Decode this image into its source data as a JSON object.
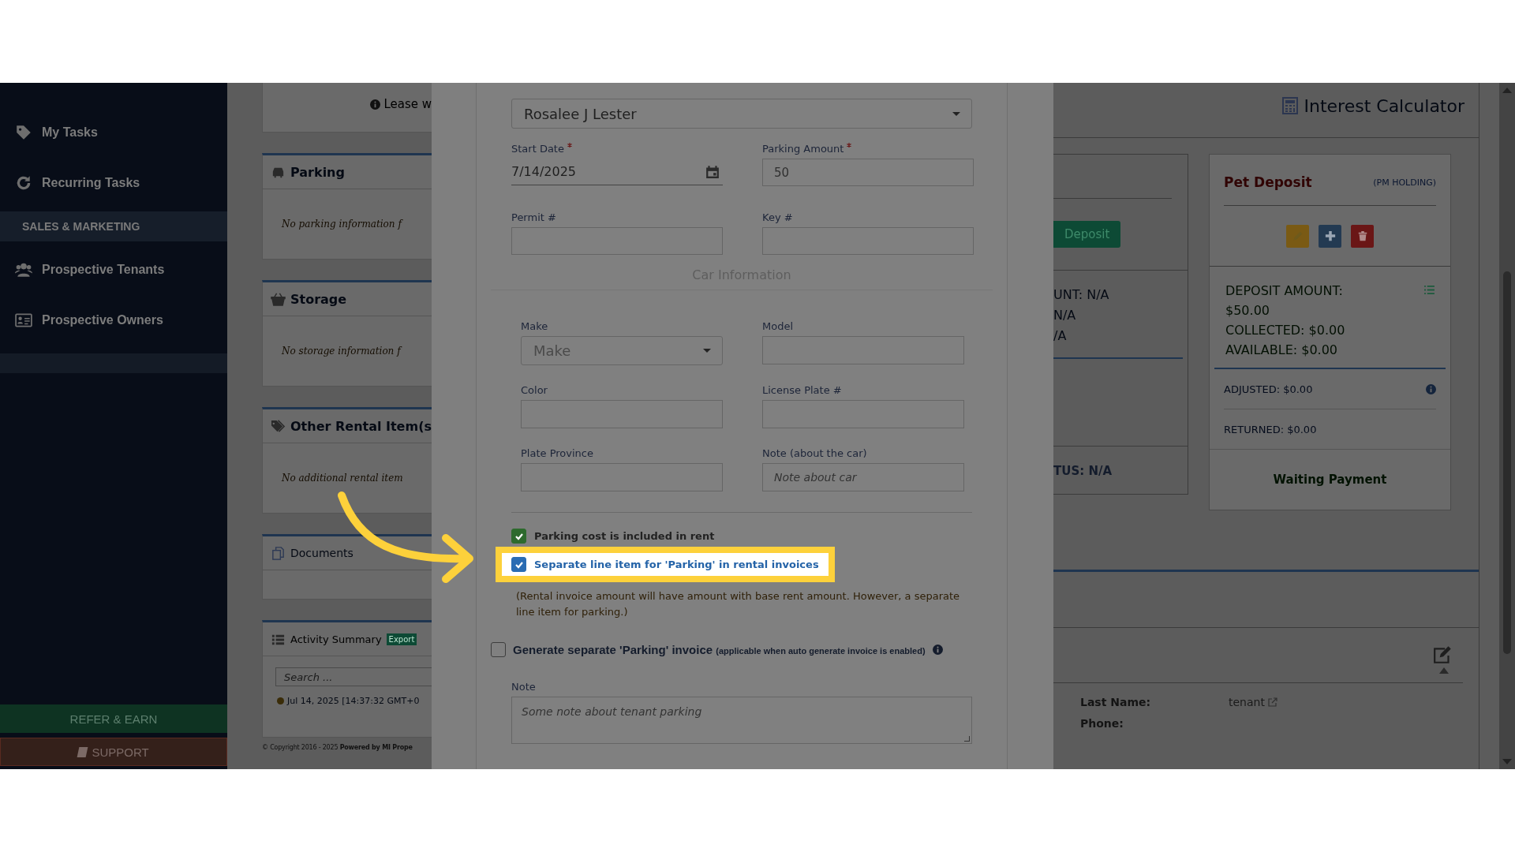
{
  "sidebar": {
    "items": [
      {
        "kind": "link",
        "label": "My Tasks"
      },
      {
        "kind": "link",
        "label": "Recurring Tasks"
      },
      {
        "kind": "section",
        "label": "SALES & MARKETING"
      },
      {
        "kind": "link",
        "label": "Prospective Tenants"
      },
      {
        "kind": "link",
        "label": "Prospective Owners"
      }
    ],
    "buttons": [
      {
        "kind": "refer",
        "label": "REFER & EARN"
      },
      {
        "kind": "support",
        "label": "SUPPORT"
      }
    ]
  },
  "background": {
    "lease_note": "Lease w",
    "sections": [
      {
        "title": "Parking",
        "message": "No parking information f"
      },
      {
        "title": "Storage",
        "message": "No storage information f"
      },
      {
        "title": "Other Rental Item(s",
        "message": "No additional rental item"
      },
      {
        "title": "Documents"
      }
    ],
    "activity": {
      "title": "Activity Summary",
      "badge": "Export",
      "search_placeholder": "Search ...",
      "entry": "Jul 14, 2025 [14:37:32 GMT+0"
    },
    "copyright": "© Copyright 2016 - 2025 **Powered by MI Prope**",
    "interest_calculator": "Interest Calculator",
    "deposit_button": "Deposit",
    "partial_lines": [
      "UNT: N/A",
      "N/A",
      "/A"
    ],
    "status_line": "TUS: N/A",
    "pet_deposit": {
      "title": "Pet Deposit",
      "holding": "(PM HOLDING)",
      "lines": [
        "DEPOSIT AMOUNT:",
        "$50.00",
        "COLLECTED: $0.00",
        "AVAILABLE: $0.00"
      ],
      "adjusted": "ADJUSTED: $0.00",
      "returned": "RETURNED: $0.00",
      "status": "Waiting Payment"
    },
    "contact": [
      {
        "label": "Last Name:",
        "value": "tenant"
      },
      {
        "label": "Phone:"
      }
    ]
  },
  "modal": {
    "tenant": "Rosalee J Lester",
    "rows": [
      [
        {
          "kind": "date",
          "label": "Start Date",
          "required": true,
          "value": "7/14/2025"
        },
        {
          "kind": "text",
          "label": "Parking Amount",
          "required": true,
          "value": "50"
        }
      ],
      [
        {
          "kind": "text",
          "label": "Permit #",
          "required": false
        },
        {
          "kind": "text",
          "label": "Key #",
          "required": false
        }
      ]
    ],
    "car_heading": "Car Information",
    "car_rows": [
      [
        {
          "kind": "select",
          "label": "Make",
          "required": false,
          "placeholder": "Make"
        },
        {
          "kind": "text",
          "label": "Model",
          "required": false
        }
      ],
      [
        {
          "kind": "text",
          "label": "Color",
          "required": false
        },
        {
          "kind": "text",
          "label": "License Plate #",
          "required": false
        }
      ],
      [
        {
          "kind": "text",
          "label": "Plate Province",
          "required": false
        },
        {
          "kind": "text",
          "label": "Note (about the car)",
          "required": false,
          "placeholder": "Note about car"
        }
      ]
    ],
    "options": [
      {
        "label": "Parking cost is included in rent",
        "checked": true,
        "highlighted": false
      },
      {
        "label": "Separate line item for 'Parking' in rental invoices",
        "checked": true,
        "highlighted": true
      }
    ],
    "hint": "(Rental invoice amount will have amount with base rent amount. However, a separate line item for parking.)",
    "generate": {
      "label": "Generate separate 'Parking' invoice",
      "note": "(applicable when auto generate invoice is enabled)",
      "checked": false
    },
    "note": {
      "label": "Note",
      "placeholder": "Some note about tenant parking"
    }
  }
}
